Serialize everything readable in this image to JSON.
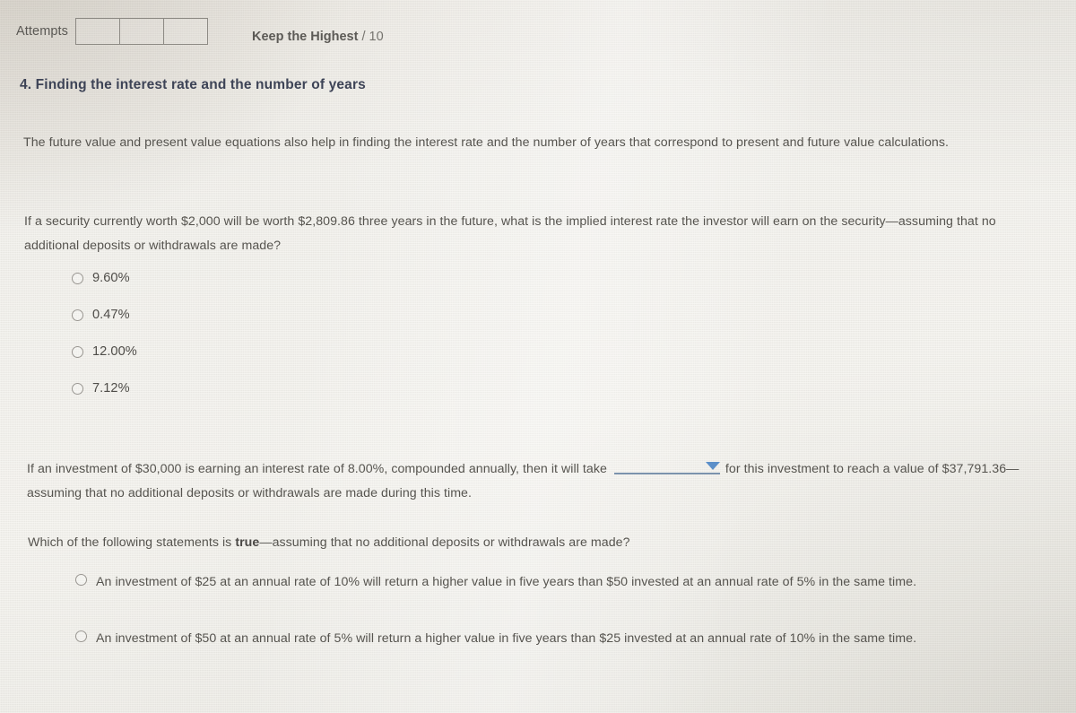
{
  "header": {
    "attempts_label": "Attempts",
    "attempts_cells": [
      "",
      "",
      ""
    ],
    "keep_highest_label": "Keep the Highest",
    "keep_highest_score": "/ 10"
  },
  "section": {
    "heading": "4. Finding the interest rate and the number of years"
  },
  "body": {
    "intro_paragraph": "The future value and present value equations also help in finding the interest rate and the number of years that correspond to present and future value calculations.",
    "question_1": "If a security currently worth $2,000 will be worth $2,809.86 three years in the future, what is the implied interest rate the investor will earn on the security—assuming that no additional deposits or withdrawals are made?",
    "question_2_before_select": "If an investment of $30,000 is earning an interest rate of 8.00%, compounded annually, then it will take",
    "question_2_after_select": "for this investment to reach a value of $37,791.36—assuming that no additional deposits or withdrawals are made during this time.",
    "question_3_prefix": "Which of the following statements is ",
    "question_3_bold": "true",
    "question_3_suffix": "—assuming that no additional deposits or withdrawals are made?"
  },
  "rate_options": [
    {
      "label": "9.60%",
      "selected": false
    },
    {
      "label": "0.47%",
      "selected": false
    },
    {
      "label": "12.00%",
      "selected": false
    },
    {
      "label": "7.12%",
      "selected": false
    }
  ],
  "true_statement_options": [
    {
      "label": "An investment of $25 at an annual rate of 10% will return a higher value in five years than $50 invested at an annual rate of 5% in the same time.",
      "selected": false
    },
    {
      "label": "An investment of $50 at an annual rate of 5% will return a higher value in five years than $25 invested at an annual rate of 10% in the same time.",
      "selected": false
    }
  ],
  "years_dropdown": {
    "selected_value": "",
    "placeholder": "",
    "caret_icon": "chevron-down-icon",
    "accent_color": "#5b8fc9",
    "underline_color": "#7b93ad"
  },
  "colors": {
    "page_background": "#f3f2ee",
    "body_text": "#56544f",
    "heading_text": "#3d4356",
    "border": "#8d8a84"
  }
}
